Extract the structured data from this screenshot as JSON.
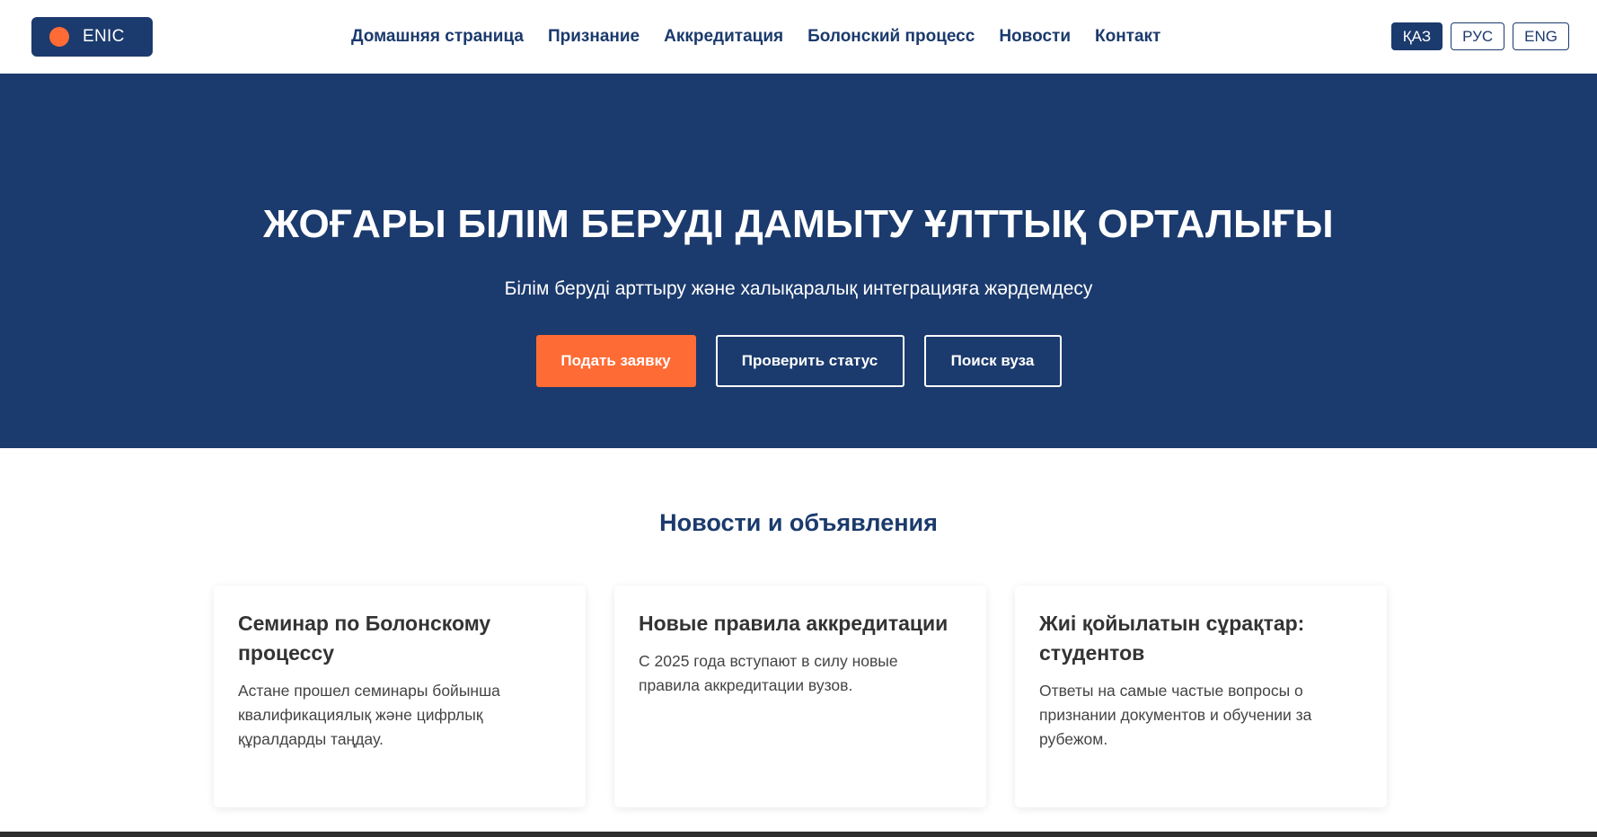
{
  "logo": {
    "text": "ENIC",
    "accent_color": "#ff6b35",
    "brand_color": "#1b3a6d"
  },
  "nav": {
    "items": [
      {
        "label": "Домашняя страница"
      },
      {
        "label": "Признание"
      },
      {
        "label": "Аккредитация"
      },
      {
        "label": "Болонский процесс"
      },
      {
        "label": "Новости"
      },
      {
        "label": "Контакт"
      }
    ]
  },
  "languages": {
    "items": [
      {
        "label": "ҚАЗ",
        "active": true
      },
      {
        "label": "РУС",
        "active": false
      },
      {
        "label": "ENG",
        "active": false
      }
    ]
  },
  "hero": {
    "title": "ЖОҒАРЫ БІЛІМ БЕРУДІ ДАМЫТУ ҰЛТТЫҚ ОРТАЛЫҒЫ",
    "subtitle": "Білім беруді арттыру және халықаралық интеграцияға жәрдемдесу",
    "apply_label": "Подать заявку",
    "status_label": "Проверить статус",
    "search_label": "Поиск вуза"
  },
  "news": {
    "heading": "Новости и объявления",
    "cards": [
      {
        "title": "Семинар по Болонскому процессу",
        "text": "Астане прошел семинары бойынша квалификациялық және цифрлық құралдарды таңдау."
      },
      {
        "title": "Новые правила аккредитации",
        "text": "С 2025 года вступают в силу новые правила аккредитации вузов."
      },
      {
        "title": "Жиі қойылатын сұрақтар: студентов",
        "text": "Ответы на самые частые вопросы о признании документов и обучении за рубежом."
      }
    ]
  }
}
